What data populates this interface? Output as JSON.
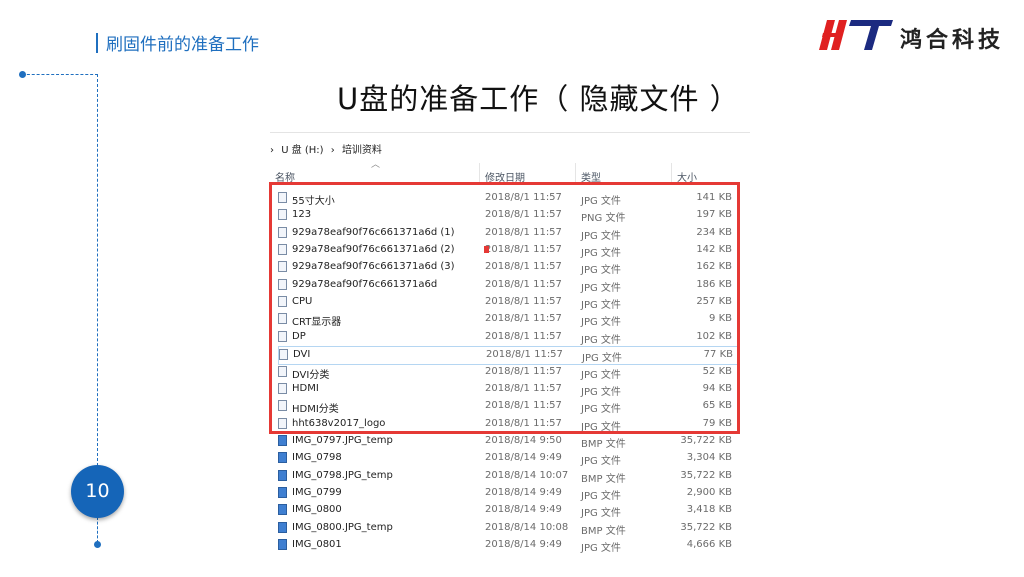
{
  "header": {
    "section_title": "刷固件前的准备工作",
    "company_name": "鸿合科技"
  },
  "slide": {
    "title": "U盘的准备工作（ 隐藏文件 ）",
    "page_number": "10"
  },
  "explorer": {
    "breadcrumb": [
      "›",
      "U 盘 (H:)",
      "›",
      "培训资料"
    ],
    "columns": {
      "name": "名称",
      "date": "修改日期",
      "type": "类型",
      "size": "大小"
    },
    "files": [
      {
        "name": "55寸大小",
        "date": "2018/8/1 11:57",
        "type": "JPG 文件",
        "size": "141 KB",
        "hidden": true
      },
      {
        "name": "123",
        "date": "2018/8/1 11:57",
        "type": "PNG 文件",
        "size": "197 KB",
        "hidden": true
      },
      {
        "name": "929a78eaf90f76c661371a6d (1)",
        "date": "2018/8/1 11:57",
        "type": "JPG 文件",
        "size": "234 KB",
        "hidden": true
      },
      {
        "name": "929a78eaf90f76c661371a6d (2)",
        "date": "2018/8/1 11:57",
        "type": "JPG 文件",
        "size": "142 KB",
        "hidden": true
      },
      {
        "name": "929a78eaf90f76c661371a6d (3)",
        "date": "2018/8/1 11:57",
        "type": "JPG 文件",
        "size": "162 KB",
        "hidden": true
      },
      {
        "name": "929a78eaf90f76c661371a6d",
        "date": "2018/8/1 11:57",
        "type": "JPG 文件",
        "size": "186 KB",
        "hidden": true
      },
      {
        "name": "CPU",
        "date": "2018/8/1 11:57",
        "type": "JPG 文件",
        "size": "257 KB",
        "hidden": true
      },
      {
        "name": "CRT显示器",
        "date": "2018/8/1 11:57",
        "type": "JPG 文件",
        "size": "9 KB",
        "hidden": true
      },
      {
        "name": "DP",
        "date": "2018/8/1 11:57",
        "type": "JPG 文件",
        "size": "102 KB",
        "hidden": true
      },
      {
        "name": "DVI",
        "date": "2018/8/1 11:57",
        "type": "JPG 文件",
        "size": "77 KB",
        "hidden": true
      },
      {
        "name": "DVI分类",
        "date": "2018/8/1 11:57",
        "type": "JPG 文件",
        "size": "52 KB",
        "hidden": true
      },
      {
        "name": "HDMI",
        "date": "2018/8/1 11:57",
        "type": "JPG 文件",
        "size": "94 KB",
        "hidden": true
      },
      {
        "name": "HDMI分类",
        "date": "2018/8/1 11:57",
        "type": "JPG 文件",
        "size": "65 KB",
        "hidden": true
      },
      {
        "name": "hht638v2017_logo",
        "date": "2018/8/1 11:57",
        "type": "JPG 文件",
        "size": "79 KB",
        "hidden": true
      },
      {
        "name": "IMG_0797.JPG_temp",
        "date": "2018/8/14 9:50",
        "type": "BMP 文件",
        "size": "35,722 KB",
        "hidden": false
      },
      {
        "name": "IMG_0798",
        "date": "2018/8/14 9:49",
        "type": "JPG 文件",
        "size": "3,304 KB",
        "hidden": false
      },
      {
        "name": "IMG_0798.JPG_temp",
        "date": "2018/8/14 10:07",
        "type": "BMP 文件",
        "size": "35,722 KB",
        "hidden": false
      },
      {
        "name": "IMG_0799",
        "date": "2018/8/14 9:49",
        "type": "JPG 文件",
        "size": "2,900 KB",
        "hidden": false
      },
      {
        "name": "IMG_0800",
        "date": "2018/8/14 9:49",
        "type": "JPG 文件",
        "size": "3,418 KB",
        "hidden": false
      },
      {
        "name": "IMG_0800.JPG_temp",
        "date": "2018/8/14 10:08",
        "type": "BMP 文件",
        "size": "35,722 KB",
        "hidden": false
      },
      {
        "name": "IMG_0801",
        "date": "2018/8/14 9:49",
        "type": "JPG 文件",
        "size": "4,666 KB",
        "hidden": false
      }
    ],
    "selected_file": "DVI"
  },
  "colors": {
    "accent": "#1f6fbf",
    "page_badge": "#1565b8",
    "highlight_box": "#e53935",
    "logo_red": "#e02020"
  },
  "icons": {
    "hidden_file": "file-outline-icon",
    "visible_file": "image-file-icon",
    "sort": "chevron-up-icon"
  }
}
